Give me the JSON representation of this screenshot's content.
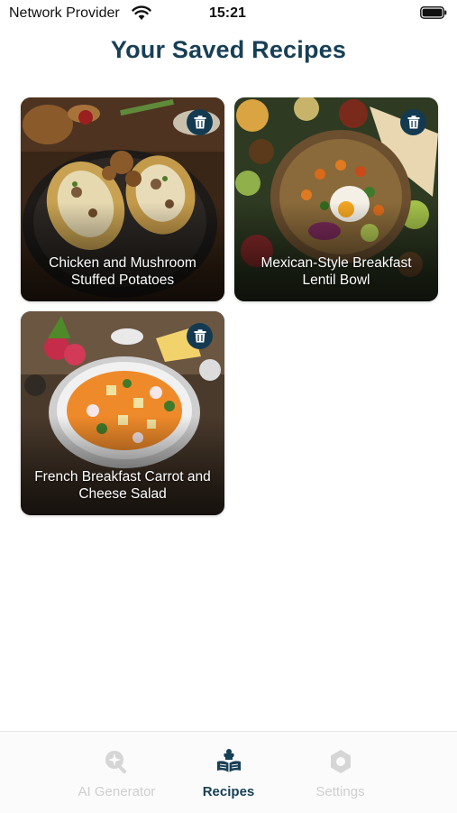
{
  "status_bar": {
    "carrier": "Network Provider",
    "time": "15:21"
  },
  "header": {
    "title": "Your Saved Recipes"
  },
  "recipes": [
    {
      "title": "Chicken and Mushroom Stuffed Potatoes"
    },
    {
      "title": "Mexican-Style Breakfast Lentil Bowl"
    },
    {
      "title": "French Breakfast Carrot and Cheese Salad"
    }
  ],
  "tabs": [
    {
      "label": "AI Generator",
      "icon": "sparkle-search-icon"
    },
    {
      "label": "Recipes",
      "icon": "chef-book-icon"
    },
    {
      "label": "Settings",
      "icon": "gear-icon"
    }
  ],
  "colors": {
    "accent": "#173f55",
    "delete_button": "#143a52",
    "inactive_tab": "#cfcfcf"
  }
}
